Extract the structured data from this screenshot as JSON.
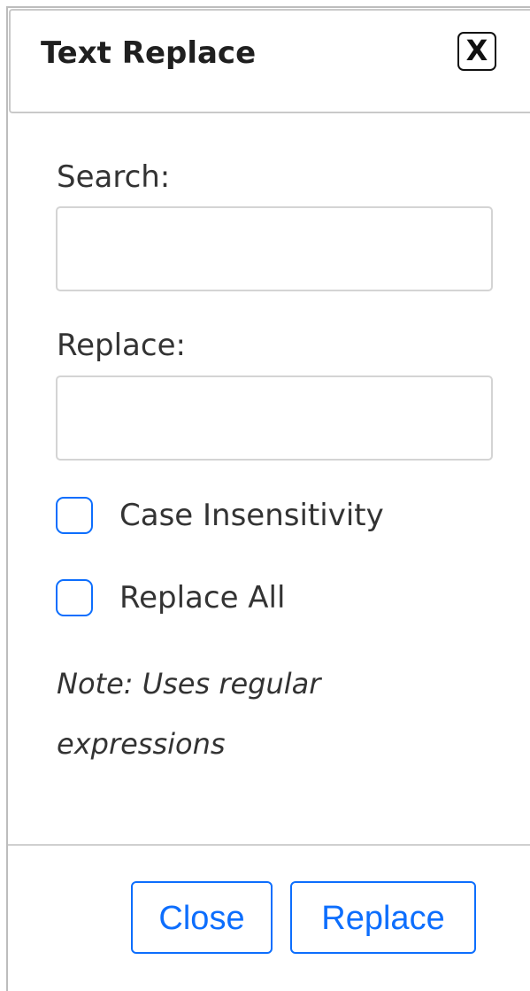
{
  "dialog": {
    "title": "Text Replace",
    "close_x": "X"
  },
  "search": {
    "label": "Search:",
    "value": "",
    "placeholder": ""
  },
  "replace": {
    "label": "Replace:",
    "value": "",
    "placeholder": ""
  },
  "options": {
    "case_insensitivity": {
      "label": "Case Insensitivity",
      "checked": false
    },
    "replace_all": {
      "label": "Replace All",
      "checked": false
    }
  },
  "note": "Note: Uses regular expressions",
  "footer": {
    "close_label": "Close",
    "replace_label": "Replace"
  },
  "colors": {
    "accent": "#0d6efd",
    "border": "#d4d4d4",
    "text": "#333333"
  }
}
